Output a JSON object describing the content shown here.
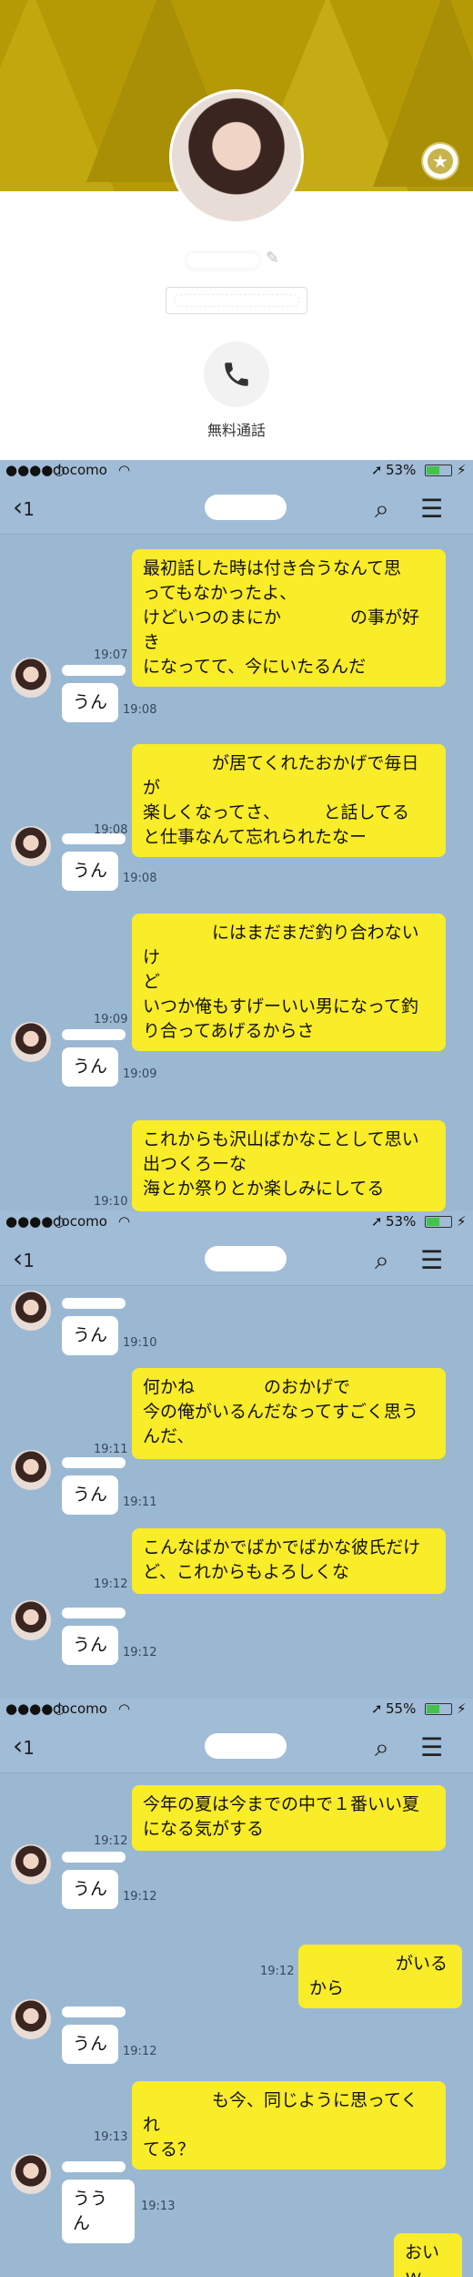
{
  "profile": {
    "call_label": "無料通話"
  },
  "chat_headers": [
    {
      "carrier": "docomo",
      "battery": "53%",
      "count": "1"
    },
    {
      "carrier": "docomo",
      "battery": "53%",
      "count": "1"
    },
    {
      "carrier": "docomo",
      "battery": "55%",
      "count": "1"
    }
  ],
  "messages": [
    {
      "side": "me",
      "lines": [
        "最初話した時は付き合うなんて思",
        "ってもなかったよ、",
        "けどいつのまにか　　　　の事が好き",
        "になってて、今にいたるんだ"
      ],
      "time": "19:07"
    },
    {
      "side": "them",
      "text": "うん",
      "time": "19:08"
    },
    {
      "side": "me",
      "lines": [
        "　　　　が居てくれたおかげで毎日が",
        "楽しくなってさ、　　　と話してる",
        "と仕事なんて忘れられたなー"
      ],
      "time": "19:08"
    },
    {
      "side": "them",
      "text": "うん",
      "time": "19:08"
    },
    {
      "side": "me",
      "lines": [
        "　　　　にはまだまだ釣り合わないけ",
        "ど",
        "いつか俺もすげーいい男になって釣",
        "り合ってあげるからさ"
      ],
      "time": "19:09"
    },
    {
      "side": "them",
      "text": "うん",
      "time": "19:09"
    },
    {
      "side": "me",
      "lines": [
        "これからも沢山ばかなことして思い",
        "出つくろーな",
        "海とか祭りとか楽しみにしてる"
      ],
      "time": "19:10"
    },
    {
      "side": "them",
      "text": "うん",
      "time": "19:10"
    },
    {
      "side": "me",
      "lines": [
        "何かね　　　　のおかげで",
        "今の俺がいるんだなってすごく思う",
        "んだ、"
      ],
      "time": "19:11"
    },
    {
      "side": "them",
      "text": "うん",
      "time": "19:11"
    },
    {
      "side": "me",
      "lines": [
        "こんなばかでばかでばかな彼氏だけ",
        "ど、これからもよろしくな"
      ],
      "time": "19:12"
    },
    {
      "side": "them",
      "text": "うん",
      "time": "19:12"
    },
    {
      "side": "me",
      "lines": [
        "今年の夏は今までの中で１番いい夏",
        "になる気がする"
      ],
      "time": "19:12"
    },
    {
      "side": "them",
      "text": "うん",
      "time": "19:12"
    },
    {
      "side": "me",
      "lines": [
        "　　　　　がいるから"
      ],
      "time": "19:12"
    },
    {
      "side": "them",
      "text": "うん",
      "time": "19:12"
    },
    {
      "side": "me",
      "lines": [
        "　　　　も今、同じように思ってくれ",
        "てる？"
      ],
      "time": "19:13"
    },
    {
      "side": "them",
      "text": "ううん",
      "time": "19:13"
    },
    {
      "side": "me",
      "lines": [
        "おいｗ"
      ],
      "time": ""
    }
  ],
  "colors": {
    "bubble_me": "#f9ec28",
    "bubble_them": "#ffffff",
    "chat_bg": "#9bb8d3",
    "banner": "#b59a06"
  }
}
